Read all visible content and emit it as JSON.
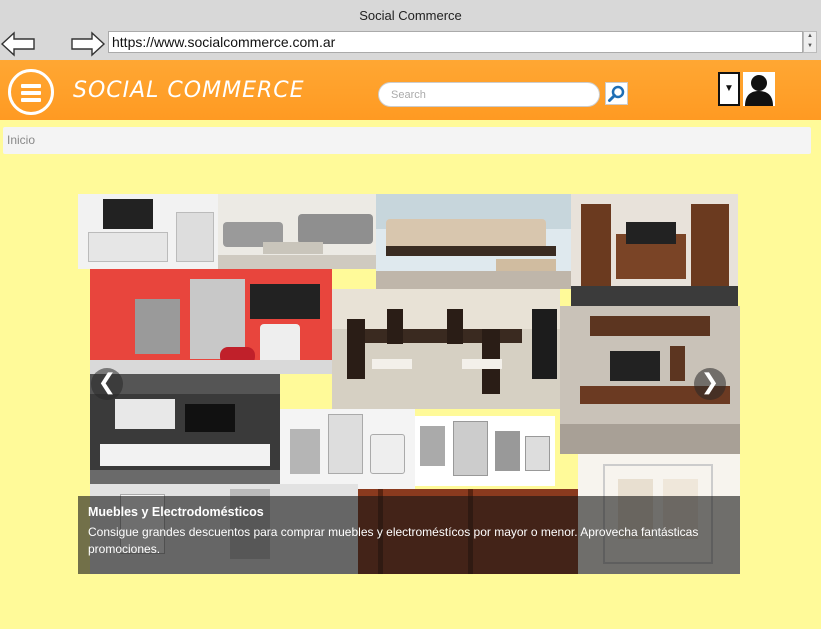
{
  "window": {
    "title": "Social Commerce"
  },
  "browser": {
    "url": "https://www.socialcommerce.com.ar"
  },
  "header": {
    "brand": "SOCIAL COMMERCE",
    "search_placeholder": "Search",
    "accent_color": "#ff9f2b"
  },
  "breadcrumb": {
    "current": "Inicio"
  },
  "carousel": {
    "caption_title": "Muebles y Electrodomésticos",
    "caption_text": "Consigue grandes descuentos para comprar muebles y electroméstícos por mayor o menor. Aprovecha fantásticas promociones.",
    "prev_glyph": "❮",
    "next_glyph": "❯"
  },
  "icons": {
    "menu": "hamburger-icon",
    "search": "magnifier-icon",
    "user": "user-silhouette-icon",
    "dropdown": "caret-down-icon"
  },
  "page_background": "#fffa99"
}
